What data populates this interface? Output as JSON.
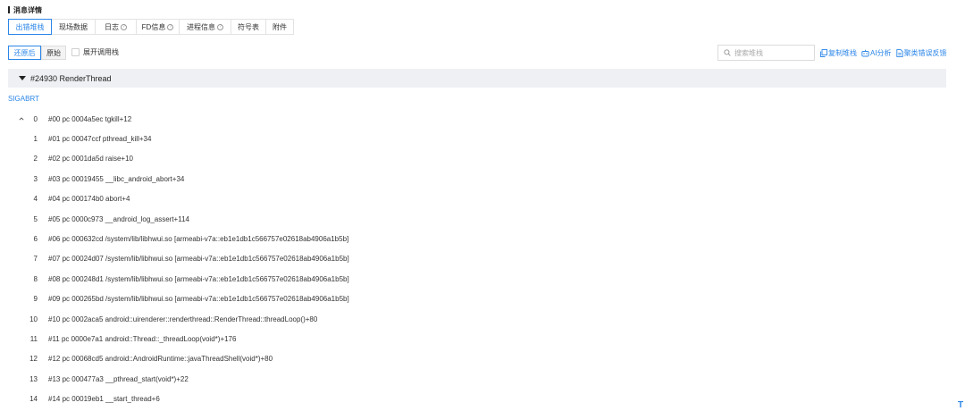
{
  "section_title": "消息详情",
  "tabs": [
    {
      "label": "出错堆栈",
      "active": true,
      "help": false
    },
    {
      "label": "现场数据",
      "active": false,
      "help": false
    },
    {
      "label": "日志",
      "active": false,
      "help": true
    },
    {
      "label": "FD信息",
      "active": false,
      "help": true
    },
    {
      "label": "进程信息",
      "active": false,
      "help": true
    },
    {
      "label": "符号表",
      "active": false,
      "help": false
    },
    {
      "label": "附件",
      "active": false,
      "help": false
    }
  ],
  "toggles": {
    "restored": "还原后",
    "original": "原始"
  },
  "expand_checkbox_label": "展开调用栈",
  "search": {
    "placeholder": "搜索堆栈"
  },
  "actions": {
    "copy": "复制堆栈",
    "ai": "AI分析",
    "feedback": "聚类错误反馈"
  },
  "thread": {
    "title": "#24930 RenderThread"
  },
  "signal": "SIGABRT",
  "frames": [
    {
      "index": "0",
      "text": "#00 pc 0004a5ec tgkill+12"
    },
    {
      "index": "1",
      "text": "#01 pc 00047ccf pthread_kill+34"
    },
    {
      "index": "2",
      "text": "#02 pc 0001da5d raise+10"
    },
    {
      "index": "3",
      "text": "#03 pc 00019455 __libc_android_abort+34"
    },
    {
      "index": "4",
      "text": "#04 pc 000174b0 abort+4"
    },
    {
      "index": "5",
      "text": "#05 pc 0000c973 __android_log_assert+114"
    },
    {
      "index": "6",
      "text": "#06 pc 000632cd /system/lib/libhwui.so [armeabi-v7a::eb1e1db1c566757e02618ab4906a1b5b]"
    },
    {
      "index": "7",
      "text": "#07 pc 00024d07 /system/lib/libhwui.so [armeabi-v7a::eb1e1db1c566757e02618ab4906a1b5b]"
    },
    {
      "index": "8",
      "text": "#08 pc 000248d1 /system/lib/libhwui.so [armeabi-v7a::eb1e1db1c566757e02618ab4906a1b5b]"
    },
    {
      "index": "9",
      "text": "#09 pc 000265bd /system/lib/libhwui.so [armeabi-v7a::eb1e1db1c566757e02618ab4906a1b5b]"
    },
    {
      "index": "10",
      "text": "#10 pc 0002aca5 android::uirenderer::renderthread::RenderThread::threadLoop()+80"
    },
    {
      "index": "11",
      "text": "#11 pc 0000e7a1 android::Thread::_threadLoop(void*)+176"
    },
    {
      "index": "12",
      "text": "#12 pc 00068cd5 android::AndroidRuntime::javaThreadShell(void*)+80"
    },
    {
      "index": "13",
      "text": "#13 pc 000477a3 __pthread_start(void*)+22"
    },
    {
      "index": "14",
      "text": "#14 pc 00019eb1 __start_thread+6"
    }
  ],
  "corner_glyph": "T",
  "colors": {
    "accent": "#2b86e8",
    "header_bg": "#eef0f3"
  }
}
